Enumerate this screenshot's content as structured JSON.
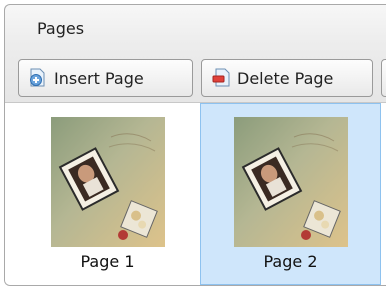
{
  "panel": {
    "title": "Pages"
  },
  "toolbar": {
    "insert_label": "Insert Page",
    "delete_label": "Delete Page"
  },
  "pages": [
    {
      "label": "Page 1",
      "selected": false
    },
    {
      "label": "Page 2",
      "selected": true
    }
  ],
  "colors": {
    "selection_fill": "#cfe6fb",
    "selection_border": "#8ec2ef"
  },
  "icons": {
    "insert": "insert-page-icon",
    "delete": "delete-page-icon"
  }
}
